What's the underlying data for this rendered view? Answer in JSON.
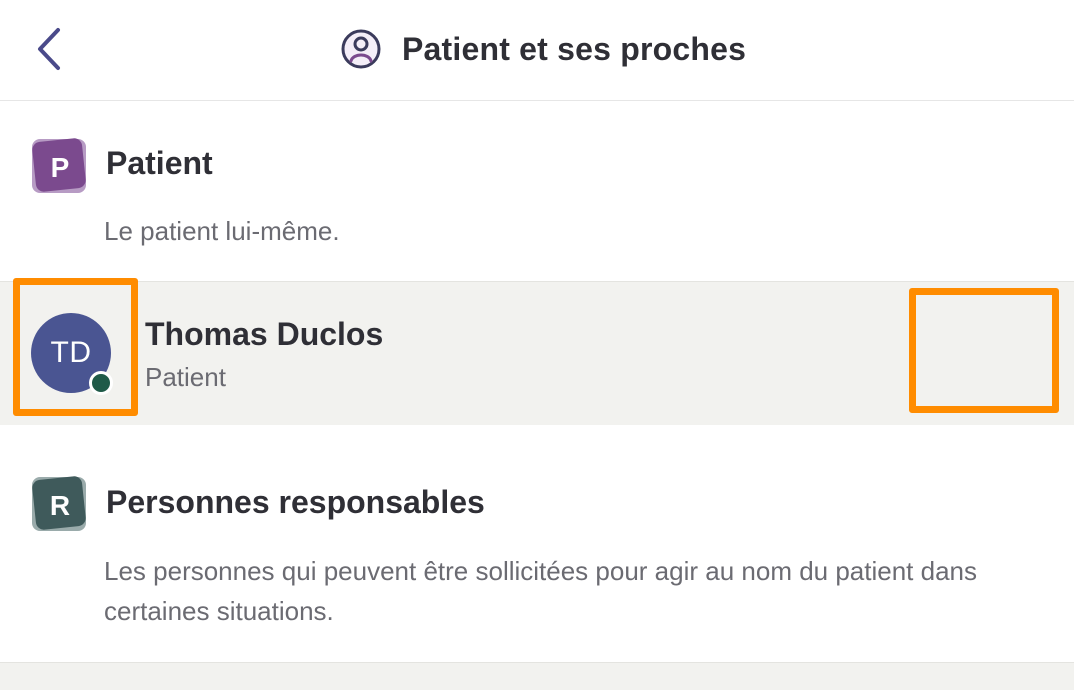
{
  "header": {
    "title": "Patient et ses proches",
    "back_icon": "chevron-left-icon",
    "title_icon": "person-circle-icon"
  },
  "sections": {
    "patient": {
      "badge_letter": "P",
      "badge_color": "#7b4a8e",
      "title": "Patient",
      "description": "Le patient lui-même."
    },
    "responsables": {
      "badge_letter": "R",
      "badge_color": "#3f5a5b",
      "title": "Personnes responsables",
      "description": "Les personnes qui peuvent être sollicitées pour agir au nom du patient dans certaines situations."
    }
  },
  "patient_row": {
    "initials": "TD",
    "name": "Thomas Duclos",
    "role": "Patient",
    "avatar_color": "#4a5592",
    "status_color": "#1f5a48"
  },
  "colors": {
    "highlight": "#ff8c00",
    "row_background": "#f2f2ef"
  }
}
